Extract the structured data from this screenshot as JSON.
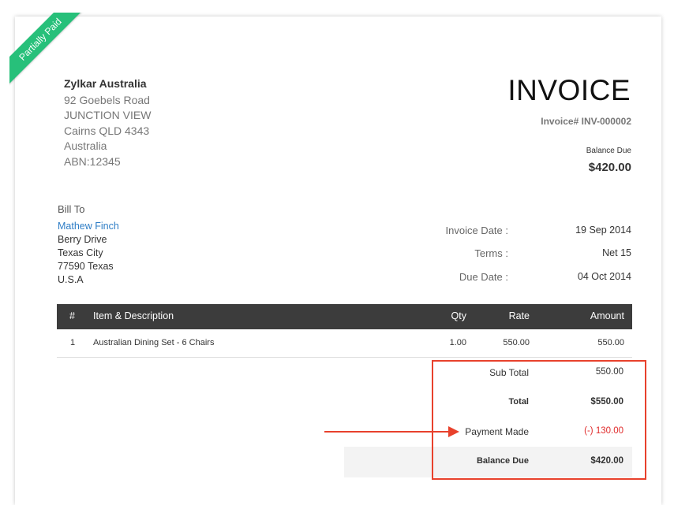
{
  "status_ribbon": "Partially Paid",
  "company": {
    "name": "Zylkar Australia",
    "address_lines": [
      "92 Goebels Road",
      "JUNCTION VIEW",
      "Cairns QLD 4343",
      "Australia",
      "ABN:12345"
    ]
  },
  "invoice": {
    "title": "INVOICE",
    "number_label": "Invoice# INV-000002",
    "balance_due_label": "Balance Due",
    "balance_due_value": "$420.00"
  },
  "bill_to": {
    "label": "Bill To",
    "customer_name": "Mathew Finch",
    "address_lines": [
      "Berry Drive",
      "Texas City",
      "77590 Texas",
      "U.S.A"
    ]
  },
  "meta": [
    {
      "label": "Invoice Date :",
      "value": "19 Sep 2014"
    },
    {
      "label": "Terms :",
      "value": "Net 15"
    },
    {
      "label": "Due Date :",
      "value": "04 Oct 2014"
    }
  ],
  "table": {
    "headers": {
      "num": "#",
      "item": "Item & Description",
      "qty": "Qty",
      "rate": "Rate",
      "amount": "Amount"
    },
    "rows": [
      {
        "num": "1",
        "item": "Australian Dining Set - 6 Chairs",
        "qty": "1.00",
        "rate": "550.00",
        "amount": "550.00"
      }
    ]
  },
  "totals": {
    "sub_total_label": "Sub Total",
    "sub_total_value": "550.00",
    "total_label": "Total",
    "total_value": "$550.00",
    "payment_label": "Payment Made",
    "payment_value": "(-) 130.00",
    "balance_label": "Balance Due",
    "balance_value": "$420.00"
  },
  "colors": {
    "ribbon": "#27c07a",
    "link": "#2e7dc6",
    "header_bg": "#3c3c3c",
    "highlight": "#e8412c",
    "negative": "#e02b2b"
  }
}
